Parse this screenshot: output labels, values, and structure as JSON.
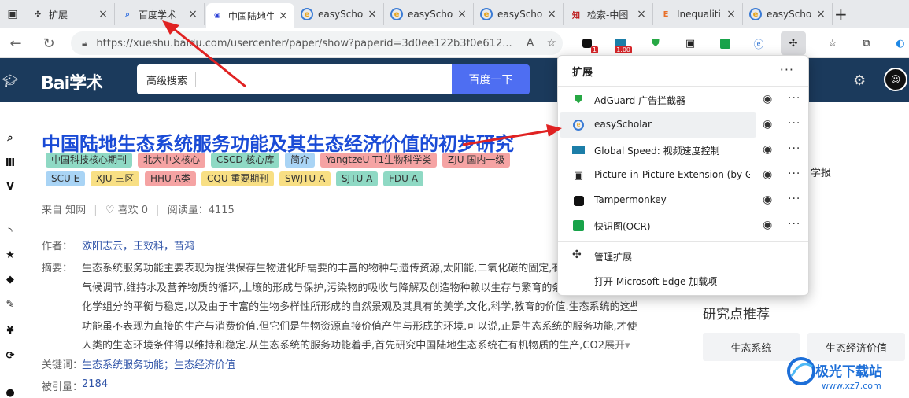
{
  "browser": {
    "tabs": [
      {
        "title": "扩展",
        "favicon": "puzzle-icon"
      },
      {
        "title": "百度学术",
        "favicon": "search-icon"
      },
      {
        "title": "中国陆地生",
        "favicon": "baidu-paw-icon"
      },
      {
        "title": "easySchol",
        "favicon": "easyscholar-icon"
      },
      {
        "title": "easySchol",
        "favicon": "easyscholar-icon"
      },
      {
        "title": "easySchol",
        "favicon": "easyscholar-icon"
      },
      {
        "title": "检索-中图",
        "favicon": "zhongtu-icon"
      },
      {
        "title": "Inequaliti",
        "favicon": "e-letter-icon"
      },
      {
        "title": "easySchol",
        "favicon": "easyscholar-icon"
      }
    ],
    "url": "https://xueshu.baidu.com/usercenter/paper/show?paperid=3d0ee122b3f0e612...",
    "toolbar_badges": {
      "tampermonkey": "1",
      "global_speed": "1.00"
    }
  },
  "site": {
    "logo": "Bai学术",
    "search_scope": "高级搜索",
    "search_placeholder": "",
    "search_button": "百度一下"
  },
  "sidebar_icons": [
    "search-icon",
    "library-icon",
    "v-icon",
    "rss-icon",
    "star-icon",
    "layers-icon",
    "pen-icon",
    "yen-icon",
    "refresh-icon"
  ],
  "paper": {
    "title": "中国陆地生态系统服务功能及其生态经济价值的初步研究",
    "tags_row1": [
      {
        "label": "中国科技核心期刊",
        "color": "#8fd9c4"
      },
      {
        "label": "北大中文核心",
        "color": "#f5a3a3"
      },
      {
        "label": "CSCD 核心库",
        "color": "#8fd9c4"
      },
      {
        "label": "简介",
        "color": "#a9d4f5"
      },
      {
        "label": "YangtzeU T1生物科学类",
        "color": "#f5a3a3"
      },
      {
        "label": "ZJU 国内一级",
        "color": "#f5a3a3"
      }
    ],
    "tags_row2": [
      {
        "label": "SCU E",
        "color": "#a9d4f5"
      },
      {
        "label": "XJU 三区",
        "color": "#f8df84"
      },
      {
        "label": "HHU A类",
        "color": "#f5a3a3"
      },
      {
        "label": "CQU 重要期刊",
        "color": "#f8df84"
      },
      {
        "label": "SWJTU A",
        "color": "#f8df84"
      },
      {
        "label": "SJTU A",
        "color": "#8fd9c4"
      },
      {
        "label": "FDU A",
        "color": "#8fd9c4"
      }
    ],
    "source": "来自 知网",
    "likes": "喜欢 0",
    "reads": "阅读量：4115",
    "authors_label": "作者：",
    "authors": "欧阳志云，王效科，苗鸿",
    "abstract_label": "摘要：",
    "abstract_lines": [
      "生态系统服务功能主要表现为提供保存生物进化所需要的丰富的物种与遗传资源,太阳能,二氧化碳的固定,有",
      "气候调节,维持水及营养物质的循环,土壤的形成与保护,污染物的吸收与降解及创造物种赖以生存与繁育的条",
      "化学组分的平衡与稳定,以及由于丰富的生物多样性所形成的自然景观及其具有的美学,文化,科学,教育的价值.生态系统的这些",
      "功能虽不表现为直接的生产与消费价值,但它们是生物资源直接价值产生与形成的环境.可以说,正是生态系统的服务功能,才使",
      "人类的生态环境条件得以维持和稳定.从生态系统的服务功能着手,首先研究中国陆地生态系统在有机物质的生产,CO2"
    ],
    "abstract_more": "展开",
    "keywords_label": "关键词：",
    "keywords": "生态系统服务功能；生态经济价值",
    "citations_label": "被引量：",
    "citations": "2184"
  },
  "right": {
    "journal_partial": "学报",
    "section_title": "研究点推荐",
    "chips": [
      "生态系统",
      "生态经济价值"
    ]
  },
  "extensions_popup": {
    "title": "扩展",
    "items": [
      {
        "label": "AdGuard 广告拦截器",
        "icon": "adguard-shield-icon"
      },
      {
        "label": "easyScholar",
        "icon": "easyscholar-icon"
      },
      {
        "label": "Global Speed: 视频速度控制",
        "icon": "global-speed-icon"
      },
      {
        "label": "Picture-in-Picture Extension (by Go...",
        "icon": "pip-icon"
      },
      {
        "label": "Tampermonkey",
        "icon": "tampermonkey-icon"
      },
      {
        "label": "快识图(OCR)",
        "icon": "ocr-icon"
      }
    ],
    "manage": "管理扩展",
    "open_addons": "打开 Microsoft Edge 加载项"
  },
  "watermark": {
    "name": "极光下载站",
    "url": "www.xz7.com"
  }
}
